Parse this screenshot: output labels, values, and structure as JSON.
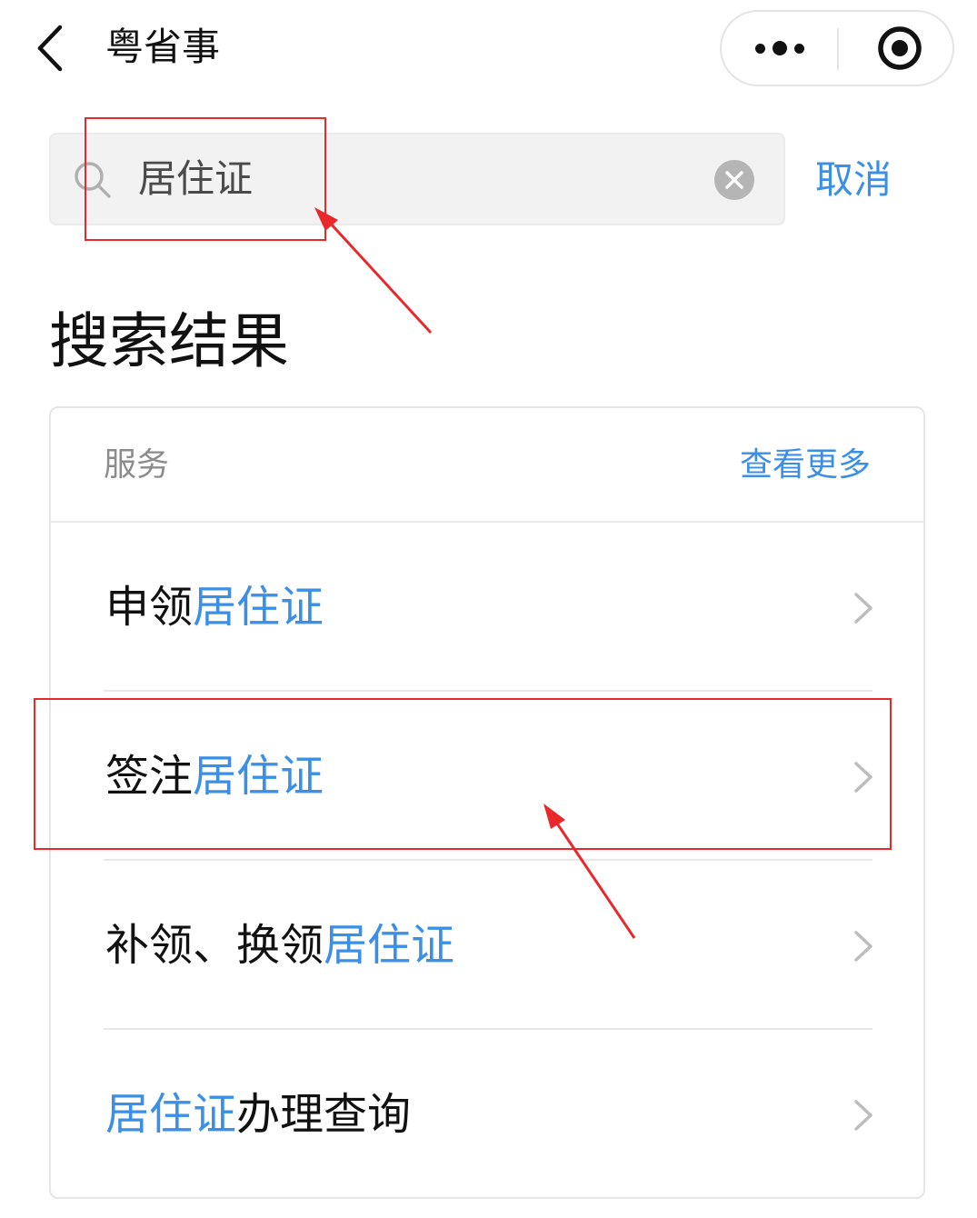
{
  "nav": {
    "title": "粤省事"
  },
  "search": {
    "value": "居住证",
    "cancel_label": "取消"
  },
  "results_title": "搜索结果",
  "services": {
    "section_label": "服务",
    "see_more_label": "查看更多",
    "items": [
      {
        "prefix": "申领",
        "highlight": "居住证",
        "suffix": ""
      },
      {
        "prefix": "签注",
        "highlight": "居住证",
        "suffix": ""
      },
      {
        "prefix": "补领、换领",
        "highlight": "居住证",
        "suffix": ""
      },
      {
        "prefix": "",
        "highlight": "居住证",
        "suffix": "办理查询"
      }
    ]
  },
  "icons": {
    "back": "back-arrow-icon",
    "more": "more-dots-icon",
    "close_miniprogram": "target-circle-icon",
    "search": "search-icon",
    "clear": "clear-icon",
    "chevron": "chevron-right-icon"
  },
  "colors": {
    "accent": "#3b8fe4",
    "annotation": "#e8282b"
  }
}
